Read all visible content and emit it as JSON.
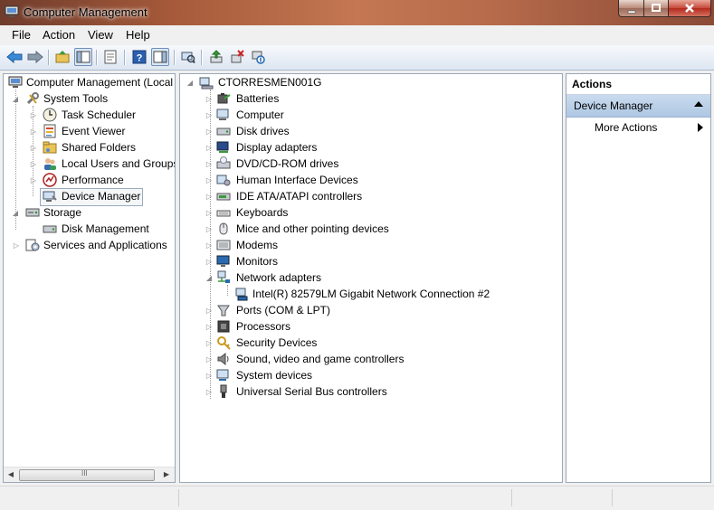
{
  "window": {
    "title": "Computer Management"
  },
  "menu": [
    "File",
    "Action",
    "View",
    "Help"
  ],
  "left_tree": {
    "root": "Computer Management (Local",
    "items": [
      {
        "label": "System Tools",
        "level": 1,
        "icon": "tools-icon"
      },
      {
        "label": "Task Scheduler",
        "level": 2,
        "icon": "clock-icon"
      },
      {
        "label": "Event Viewer",
        "level": 2,
        "icon": "event-viewer-icon"
      },
      {
        "label": "Shared Folders",
        "level": 2,
        "icon": "shared-folder-icon"
      },
      {
        "label": "Local Users and Groups",
        "level": 2,
        "icon": "users-icon"
      },
      {
        "label": "Performance",
        "level": 2,
        "icon": "performance-icon"
      },
      {
        "label": "Device Manager",
        "level": 2,
        "icon": "device-manager-icon"
      },
      {
        "label": "Storage",
        "level": 1,
        "icon": "storage-icon"
      },
      {
        "label": "Disk Management",
        "level": 2,
        "icon": "disk-icon"
      },
      {
        "label": "Services and Applications",
        "level": 1,
        "icon": "services-icon"
      }
    ]
  },
  "device_tree": {
    "root": "CTORRESMEN001G",
    "items": [
      {
        "label": "Batteries",
        "icon": "battery-icon"
      },
      {
        "label": "Computer",
        "icon": "computer-icon"
      },
      {
        "label": "Disk drives",
        "icon": "disk-drive-icon"
      },
      {
        "label": "Display adapters",
        "icon": "display-adapter-icon"
      },
      {
        "label": "DVD/CD-ROM drives",
        "icon": "dvd-icon"
      },
      {
        "label": "Human Interface Devices",
        "icon": "hid-icon"
      },
      {
        "label": "IDE ATA/ATAPI controllers",
        "icon": "ide-icon"
      },
      {
        "label": "Keyboards",
        "icon": "keyboard-icon"
      },
      {
        "label": "Mice and other pointing devices",
        "icon": "mouse-icon"
      },
      {
        "label": "Modems",
        "icon": "modem-icon"
      },
      {
        "label": "Monitors",
        "icon": "monitor-icon"
      },
      {
        "label": "Network adapters",
        "icon": "network-icon"
      },
      {
        "label": "Intel(R) 82579LM Gigabit Network Connection #2",
        "icon": "network-card-icon"
      },
      {
        "label": "Ports (COM & LPT)",
        "icon": "port-icon"
      },
      {
        "label": "Processors",
        "icon": "processor-icon"
      },
      {
        "label": "Security Devices",
        "icon": "security-icon"
      },
      {
        "label": "Sound, video and game controllers",
        "icon": "sound-icon"
      },
      {
        "label": "System devices",
        "icon": "system-devices-icon"
      },
      {
        "label": "Universal Serial Bus controllers",
        "icon": "usb-icon"
      }
    ]
  },
  "actions": {
    "header": "Actions",
    "section": "Device Manager",
    "more": "More Actions"
  },
  "scroll": {
    "thumb_glyph": "III"
  }
}
